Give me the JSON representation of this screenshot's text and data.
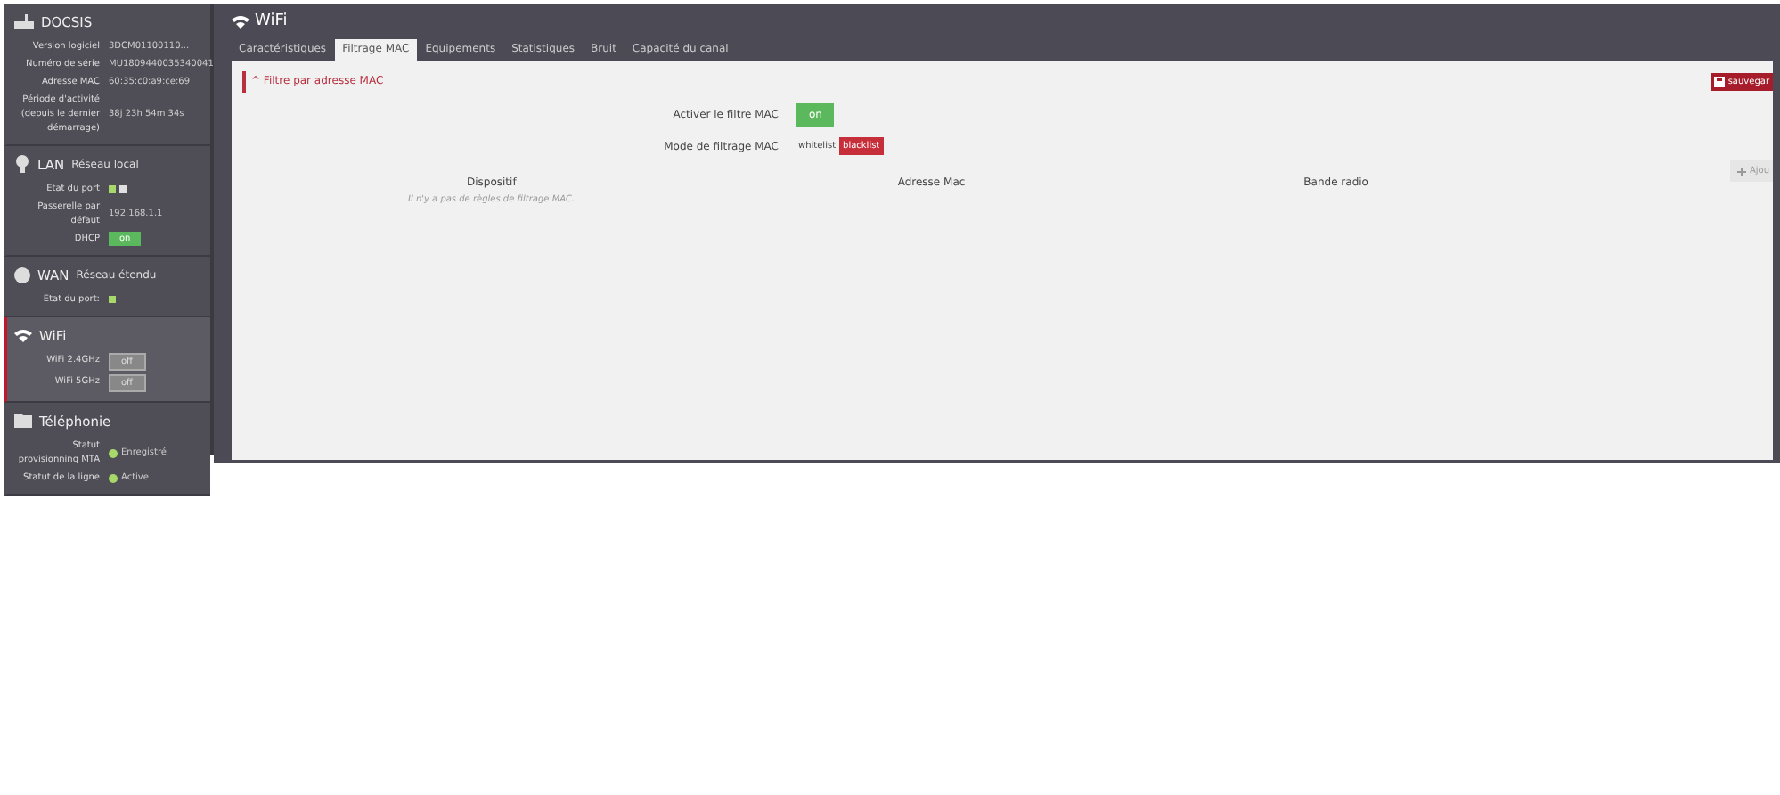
{
  "sidebar": [
    {
      "title": "DOCSIS",
      "selected": false,
      "rows": [
        {
          "label": "Version logiciel",
          "kind": "text",
          "value": "3DCM01100110..."
        },
        {
          "label": "Numéro de série",
          "kind": "text",
          "value": "MU1809440035340041"
        },
        {
          "label": "Adresse MAC",
          "kind": "text",
          "value": "60:35:c0:a9:ce:69"
        },
        {
          "label": "Période d'activité (depuis le dernier démarrage)",
          "kind": "text",
          "value": "38j 23h 54m 34s"
        }
      ]
    },
    {
      "title": "LAN",
      "subtitle": "Réseau local",
      "selected": false,
      "rows": [
        {
          "label": "Etat du port",
          "kind": "ports",
          "ports": [
            {
              "color": "#a8d86a"
            },
            {
              "color": "#e0e0e0"
            }
          ]
        },
        {
          "label": "Passerelle par défaut",
          "kind": "text",
          "value": "192.168.1.1"
        },
        {
          "label": "DHCP",
          "kind": "toggle",
          "value": "on",
          "on": true
        }
      ]
    },
    {
      "title": "WAN",
      "subtitle": "Réseau étendu",
      "selected": false,
      "rows": [
        {
          "label": "Etat du port:",
          "kind": "ports",
          "ports": [
            {
              "color": "#a8d86a"
            }
          ]
        }
      ]
    },
    {
      "title": "WiFi",
      "selected": true,
      "rows": [
        {
          "label": "WiFi 2.4GHz",
          "kind": "toggle",
          "value": "off",
          "on": false
        },
        {
          "label": "WiFi 5GHz",
          "kind": "toggle",
          "value": "off",
          "on": false
        }
      ]
    },
    {
      "title": "Téléphonie",
      "selected": false,
      "rows": [
        {
          "label": "Statut provisionning MTA",
          "kind": "status",
          "value": "Enregistré",
          "color": "#a8d86a"
        },
        {
          "label": "Statut de la ligne",
          "kind": "status",
          "value": "Active",
          "color": "#a8d86a"
        }
      ]
    }
  ],
  "page": {
    "title": "WiFi",
    "tabs": [
      {
        "label": "Caractéristiques",
        "selected": false
      },
      {
        "label": "Filtrage MAC",
        "selected": true
      },
      {
        "label": "Equipements",
        "selected": false
      },
      {
        "label": "Statistiques",
        "selected": false
      },
      {
        "label": "Bruit",
        "selected": false
      },
      {
        "label": "Capacité du canal",
        "selected": false
      }
    ],
    "section_title": "^ Filtre par adresse MAC",
    "save_button": "sauvegar",
    "enable_label": "Activer le filtre MAC",
    "enable_toggle": {
      "value": "on",
      "on": true
    },
    "mode_label": "Mode de filtrage MAC",
    "modes": [
      {
        "label": "whitelist",
        "selected": false
      },
      {
        "label": "blacklist",
        "selected": true
      }
    ],
    "add_button": "Ajou",
    "table": {
      "columns": [
        "Dispositif",
        "Adresse Mac",
        "Bande radio"
      ],
      "empty": "Il n'y a pas de règles de filtrage MAC."
    }
  }
}
